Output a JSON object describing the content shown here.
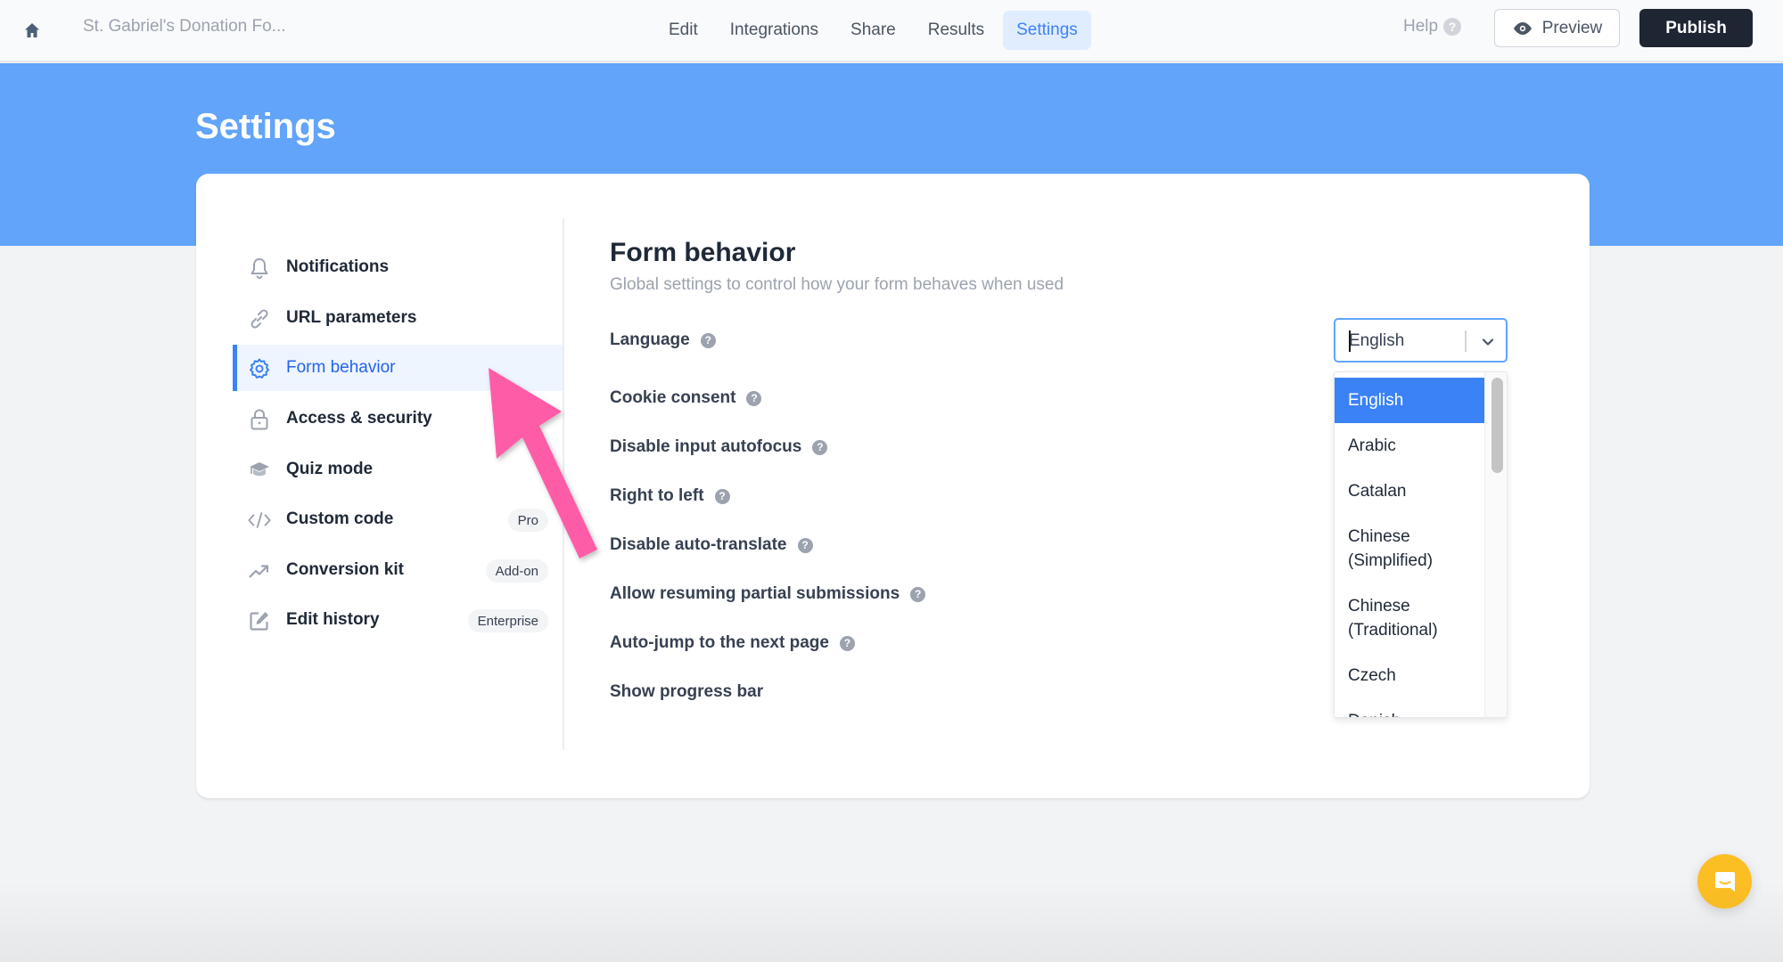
{
  "topbar": {
    "form_title": "St. Gabriel's Donation Fo...",
    "nav_tabs": [
      {
        "label": "Edit",
        "active": false
      },
      {
        "label": "Integrations",
        "active": false
      },
      {
        "label": "Share",
        "active": false
      },
      {
        "label": "Results",
        "active": false
      },
      {
        "label": "Settings",
        "active": true
      }
    ],
    "help_label": "Help",
    "help_icon_glyph": "?",
    "preview_label": "Preview",
    "publish_label": "Publish"
  },
  "page": {
    "title": "Settings"
  },
  "sidebar": {
    "items": [
      {
        "label": "Notifications",
        "icon": "bell-icon",
        "badge": null,
        "active": false
      },
      {
        "label": "URL parameters",
        "icon": "link-icon",
        "badge": null,
        "active": false
      },
      {
        "label": "Form behavior",
        "icon": "gear-icon",
        "badge": null,
        "active": true
      },
      {
        "label": "Access & security",
        "icon": "lock-icon",
        "badge": null,
        "active": false
      },
      {
        "label": "Quiz mode",
        "icon": "graduation-cap-icon",
        "badge": null,
        "active": false
      },
      {
        "label": "Custom code",
        "icon": "code-icon",
        "badge": "Pro",
        "active": false
      },
      {
        "label": "Conversion kit",
        "icon": "trending-up-icon",
        "badge": "Add-on",
        "active": false
      },
      {
        "label": "Edit history",
        "icon": "edit-icon",
        "badge": "Enterprise",
        "active": false
      }
    ]
  },
  "content": {
    "title": "Form behavior",
    "subtitle": "Global settings to control how your form behaves when used",
    "help_glyph": "?",
    "settings": [
      {
        "label": "Language",
        "has_help": true
      },
      {
        "label": "Cookie consent",
        "has_help": true
      },
      {
        "label": "Disable input autofocus",
        "has_help": true
      },
      {
        "label": "Right to left",
        "has_help": true
      },
      {
        "label": "Disable auto-translate",
        "has_help": true
      },
      {
        "label": "Allow resuming partial submissions",
        "has_help": true
      },
      {
        "label": "Auto-jump to the next page",
        "has_help": true
      },
      {
        "label": "Show progress bar",
        "has_help": false
      }
    ],
    "language_select": {
      "value": "English",
      "options": [
        "English",
        "Arabic",
        "Catalan",
        "Chinese (Simplified)",
        "Chinese (Traditional)",
        "Czech",
        "Danish"
      ],
      "selected": "English"
    }
  },
  "colors": {
    "accent": "#3b82f6",
    "hero": "#61a4f9",
    "publish": "#1e2533",
    "annotation_arrow": "#ff5ba8",
    "chat": "#fbbf24"
  }
}
